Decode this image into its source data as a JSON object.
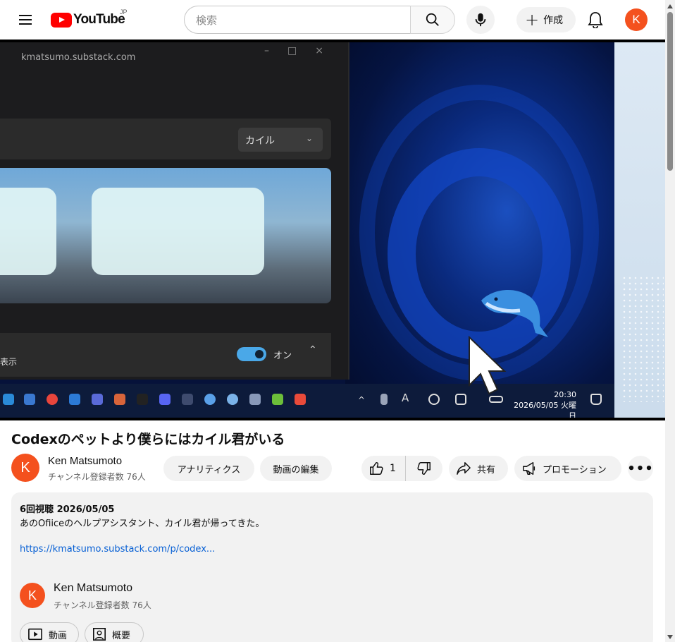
{
  "header": {
    "logo_text": "YouTube",
    "logo_region": "JP",
    "search_placeholder": "検索",
    "create_label": "作成",
    "avatar_letter": "K"
  },
  "video": {
    "window_url": "kmatsumo.substack.com",
    "dropdown_value": "カイル",
    "toggle_label": "オン",
    "side_label": "表示",
    "clock_time": "20:30",
    "clock_date": "2026/05/05 火曜日"
  },
  "title": "Codexのペットより僕らにはカイル君がいる",
  "channel": {
    "avatar_letter": "K",
    "name": "Ken Matsumoto",
    "subscribers": "チャンネル登録者数 76人"
  },
  "actions": {
    "analytics": "アナリティクス",
    "edit_video": "動画の編集",
    "like_count": "1",
    "share": "共有",
    "promotion": "プロモーション",
    "more": "•••"
  },
  "description": {
    "stats": "6回視聴  2026/05/05",
    "text": "あのOfiiceのヘルプアシスタント、カイル君が帰ってきた。",
    "link": "https://kmatsumo.substack.com/p/codex...",
    "channel_avatar_letter": "K",
    "channel_name": "Ken Matsumoto",
    "channel_subscribers": "チャンネル登録者数 76人",
    "videos_button": "動画",
    "about_button": "概要"
  },
  "colors": {
    "brand_red": "#ff0000",
    "avatar": "#f4511e",
    "link": "#065fd4"
  }
}
